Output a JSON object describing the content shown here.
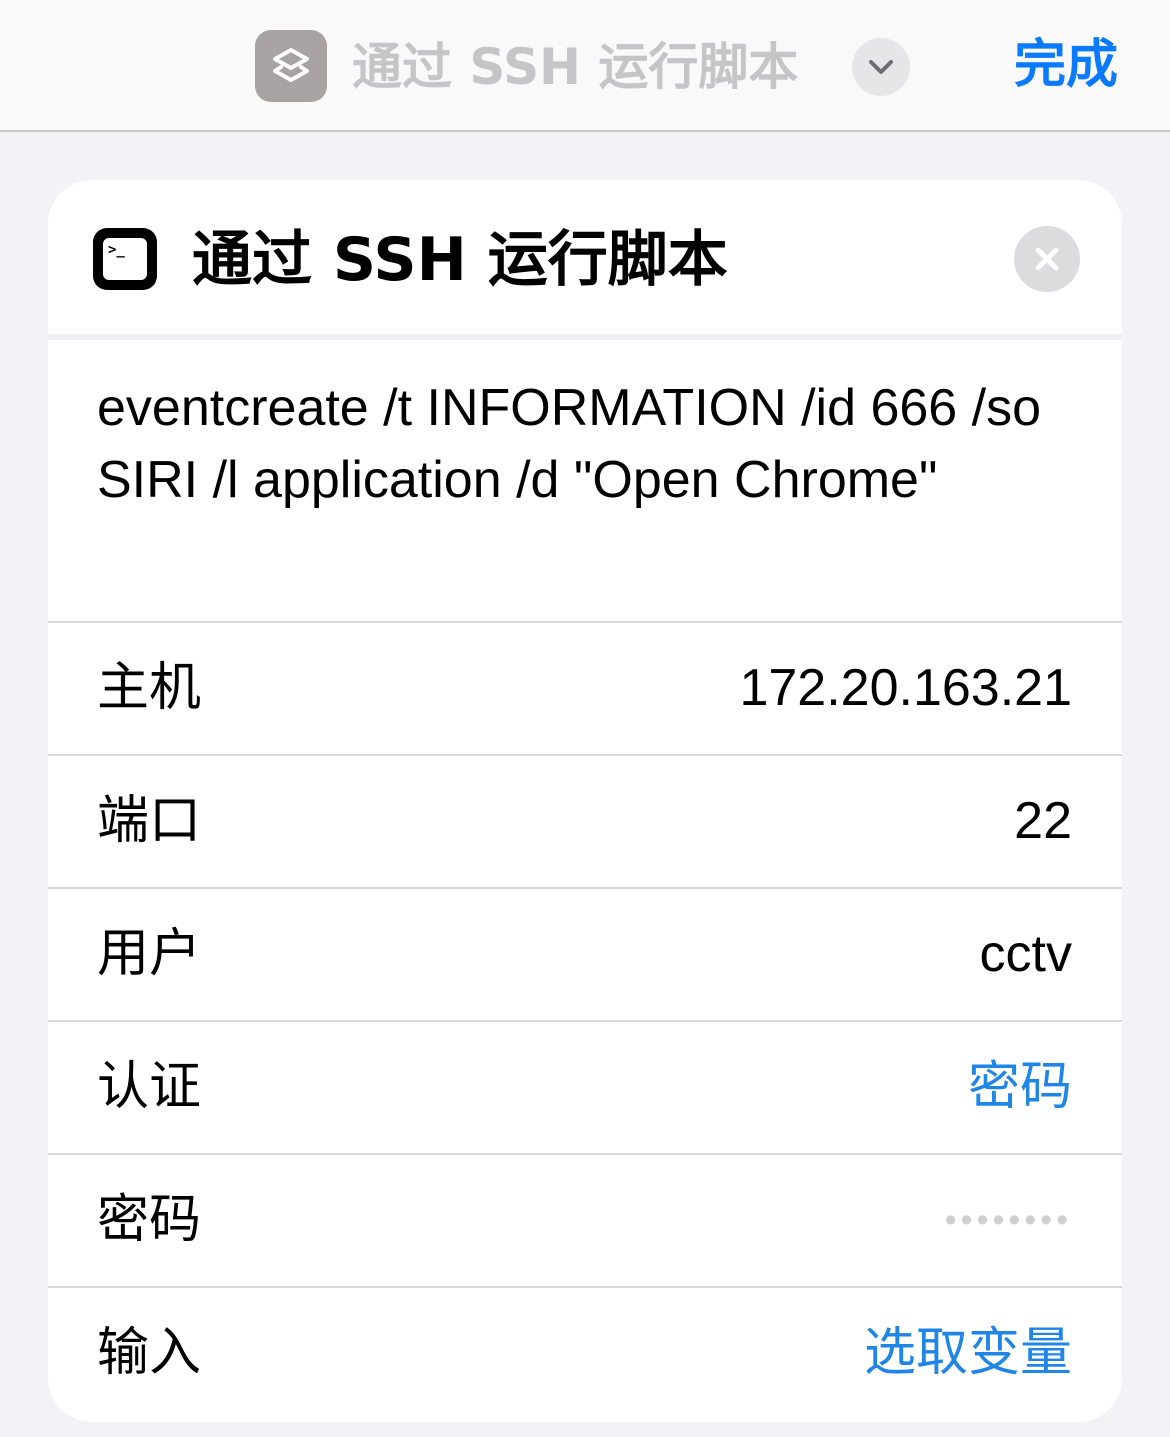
{
  "nav": {
    "title": "通过 SSH 运行脚本",
    "done_label": "完成",
    "app_icon": "shortcuts-layers-icon",
    "chevron_icon": "chevron-down-icon"
  },
  "action": {
    "icon": "terminal-icon",
    "icon_prompt": ">_",
    "title": "通过 SSH 运行脚本",
    "close_icon": "close-icon",
    "script": "eventcreate /t INFORMATION /id 666 /so SIRI /l application /d \"Open Chrome\""
  },
  "fields": [
    {
      "label": "主机",
      "value": "172.20.163.21"
    },
    {
      "label": "端口",
      "value": "22"
    },
    {
      "label": "用户",
      "value": "cctv"
    },
    {
      "label": "认证",
      "value": "密码"
    },
    {
      "label": "密码",
      "value": "••••••••"
    },
    {
      "label": "输入",
      "value": "选取变量"
    }
  ],
  "colors": {
    "accent": "#0a7aff",
    "link": "#1f86e8",
    "background": "#f2f2f7"
  }
}
